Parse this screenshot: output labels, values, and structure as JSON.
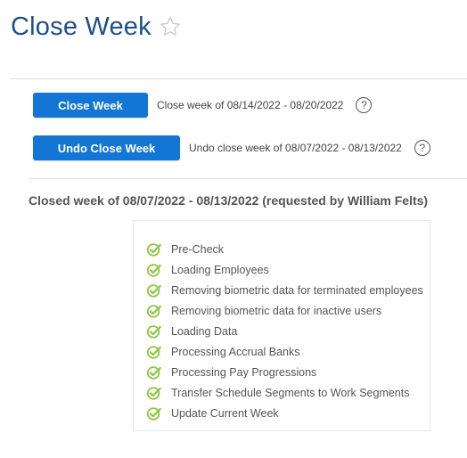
{
  "header": {
    "title": "Close Week",
    "favorite_icon": "star-outline-icon"
  },
  "actions": {
    "close": {
      "label": "Close Week",
      "description": "Close week of 08/14/2022 - 08/20/2022",
      "help": "?"
    },
    "undo": {
      "label": "Undo Close Week",
      "description": "Undo close week of 08/07/2022 - 08/13/2022",
      "help": "?"
    }
  },
  "status": {
    "heading": "Closed week of 08/07/2022 - 08/13/2022 (requested by William Felts)",
    "step_icon": "check-circle-icon",
    "steps": [
      "Pre-Check",
      "Loading Employees",
      "Removing biometric data for terminated employees",
      "Removing biometric data for inactive users",
      "Loading Data",
      "Processing Accrual Banks",
      "Processing Pay Progressions",
      "Transfer Schedule Segments to Work Segments",
      "Update Current Week"
    ]
  },
  "colors": {
    "title": "#1d4f8b",
    "button": "#1476d4",
    "check": "#8cc63f"
  }
}
